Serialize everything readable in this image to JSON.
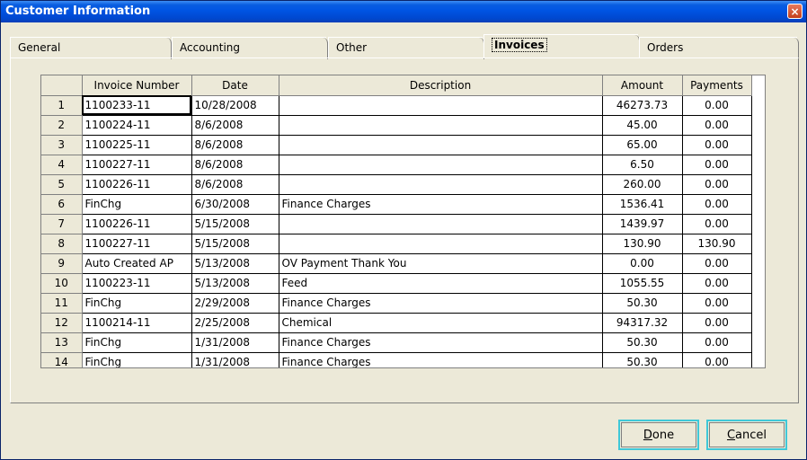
{
  "window": {
    "title": "Customer Information",
    "close_glyph": "×"
  },
  "tabs": [
    {
      "label": "General"
    },
    {
      "label": "Accounting"
    },
    {
      "label": "Other"
    },
    {
      "label": "Invoices",
      "active": true
    },
    {
      "label": "Orders"
    }
  ],
  "grid": {
    "columns": [
      "",
      "Invoice Number",
      "Date",
      "Description",
      "Amount",
      "Payments"
    ],
    "rows": [
      {
        "n": "1",
        "invoice": "1100233-11",
        "date": "10/28/2008",
        "desc": "",
        "amount": "46273.73",
        "payments": "0.00"
      },
      {
        "n": "2",
        "invoice": "1100224-11",
        "date": "8/6/2008",
        "desc": "",
        "amount": "45.00",
        "payments": "0.00"
      },
      {
        "n": "3",
        "invoice": "1100225-11",
        "date": "8/6/2008",
        "desc": "",
        "amount": "65.00",
        "payments": "0.00"
      },
      {
        "n": "4",
        "invoice": "1100227-11",
        "date": "8/6/2008",
        "desc": "",
        "amount": "6.50",
        "payments": "0.00"
      },
      {
        "n": "5",
        "invoice": "1100226-11",
        "date": "8/6/2008",
        "desc": "",
        "amount": "260.00",
        "payments": "0.00"
      },
      {
        "n": "6",
        "invoice": "FinChg",
        "date": "6/30/2008",
        "desc": "Finance Charges",
        "amount": "1536.41",
        "payments": "0.00"
      },
      {
        "n": "7",
        "invoice": "1100226-11",
        "date": "5/15/2008",
        "desc": "",
        "amount": "1439.97",
        "payments": "0.00"
      },
      {
        "n": "8",
        "invoice": "1100227-11",
        "date": "5/15/2008",
        "desc": "",
        "amount": "130.90",
        "payments": "130.90"
      },
      {
        "n": "9",
        "invoice": "Auto Created AP",
        "date": "5/13/2008",
        "desc": "OV Payment Thank You",
        "amount": "0.00",
        "payments": "0.00"
      },
      {
        "n": "10",
        "invoice": "1100223-11",
        "date": "5/13/2008",
        "desc": "Feed",
        "amount": "1055.55",
        "payments": "0.00"
      },
      {
        "n": "11",
        "invoice": "FinChg",
        "date": "2/29/2008",
        "desc": "Finance Charges",
        "amount": "50.30",
        "payments": "0.00"
      },
      {
        "n": "12",
        "invoice": "1100214-11",
        "date": "2/25/2008",
        "desc": "Chemical",
        "amount": "94317.32",
        "payments": "0.00"
      },
      {
        "n": "13",
        "invoice": "FinChg",
        "date": "1/31/2008",
        "desc": "Finance Charges",
        "amount": "50.30",
        "payments": "0.00"
      },
      {
        "n": "14",
        "invoice": "FinChg",
        "date": "1/31/2008",
        "desc": "Finance Charges",
        "amount": "50.30",
        "payments": "0.00"
      }
    ]
  },
  "scrollbar": {
    "up_glyph": "▲",
    "down_glyph": "▼"
  },
  "buttons": {
    "done": {
      "mnemonic": "D",
      "rest": "one"
    },
    "cancel": {
      "mnemonic": "C",
      "rest": "ancel"
    }
  },
  "colors": {
    "title_bar": "#0054e3",
    "window_bg": "#ece9d8",
    "button_focus": "#3fc8d8",
    "close": "#c43f1c"
  }
}
